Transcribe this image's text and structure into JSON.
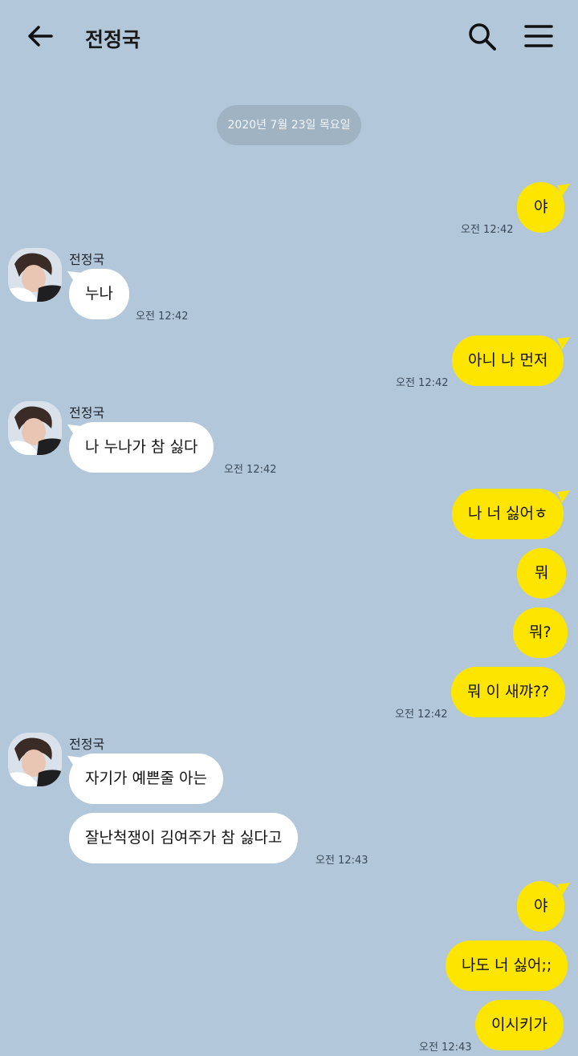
{
  "header": {
    "title": "전정국",
    "back_icon": "arrow-left-icon",
    "search_icon": "search-icon",
    "menu_icon": "hamburger-menu-icon"
  },
  "date_divider": "2020년 7월 23일 목요일",
  "colors": {
    "background": "#b2c7d9",
    "my_bubble": "#fee500",
    "their_bubble": "#ffffff"
  },
  "sender_name": "전정국",
  "messages": [
    {
      "id": "m1",
      "from": "me",
      "text": "야",
      "time": "오전 12:42"
    },
    {
      "id": "m2",
      "from": "them",
      "text": "누나",
      "time": "오전 12:42"
    },
    {
      "id": "m3",
      "from": "me",
      "text": "아니 나 먼저",
      "time": "오전 12:42"
    },
    {
      "id": "m4",
      "from": "them",
      "text": "나 누나가 참 싫다",
      "time": "오전 12:42"
    },
    {
      "id": "m5",
      "from": "me",
      "text": "나 너 싫어ㅎ"
    },
    {
      "id": "m6",
      "from": "me",
      "text": "뭐"
    },
    {
      "id": "m7",
      "from": "me",
      "text": "뭐?"
    },
    {
      "id": "m8",
      "from": "me",
      "text": "뭐 이 새꺄??",
      "time": "오전 12:42"
    },
    {
      "id": "m9",
      "from": "them",
      "text": "자기가 예쁜줄 아는"
    },
    {
      "id": "m10",
      "from": "them",
      "text": "잘난척쟁이 김여주가 참 싫다고",
      "time": "오전 12:43"
    },
    {
      "id": "m11",
      "from": "me",
      "text": "야"
    },
    {
      "id": "m12",
      "from": "me",
      "text": "나도 너 싫어;;"
    },
    {
      "id": "m13",
      "from": "me",
      "text": "이시키가",
      "time": "오전 12:43"
    }
  ]
}
